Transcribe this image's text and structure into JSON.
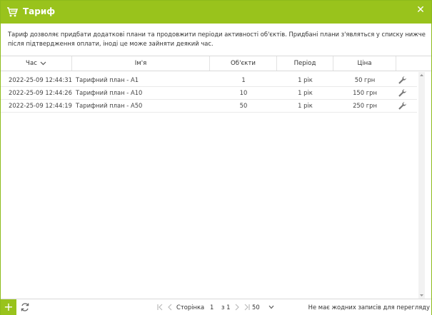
{
  "window": {
    "title": "Тариф",
    "icon": "shopping-cart-icon",
    "close_icon": "close-icon",
    "accent_color": "#99c31c"
  },
  "description": "Тариф дозволяє придбати додаткові плани та продовжити періоди активності об'єктів. Придбані плани з'являться у списку нижче після підтвердження оплати, іноді це може зайняти деякий час.",
  "table": {
    "columns": [
      "Час",
      "Ім'я",
      "Об'єкти",
      "Період",
      "Ціна"
    ],
    "sort_column": "Час",
    "sort_direction": "desc",
    "rows": [
      {
        "time": "2022-25-09 12:44:31",
        "name": "Тарифний план - A1",
        "objects": "1",
        "period": "1 рік",
        "price": "50 грн",
        "action_icon": "wrench-icon"
      },
      {
        "time": "2022-25-09 12:44:26",
        "name": "Тарифний план - A10",
        "objects": "10",
        "period": "1 рік",
        "price": "150 грн",
        "action_icon": "wrench-icon"
      },
      {
        "time": "2022-25-09 12:44:19",
        "name": "Тарифний план - A50",
        "objects": "50",
        "period": "1 рік",
        "price": "250 грн",
        "action_icon": "wrench-icon"
      }
    ]
  },
  "footer": {
    "add_label": "+",
    "refresh_icon": "refresh-icon",
    "page_label": "Сторінка",
    "page_value": "1",
    "of_label": "з 1",
    "page_size": "50",
    "status": "Не має жодних записів для перегляду"
  }
}
